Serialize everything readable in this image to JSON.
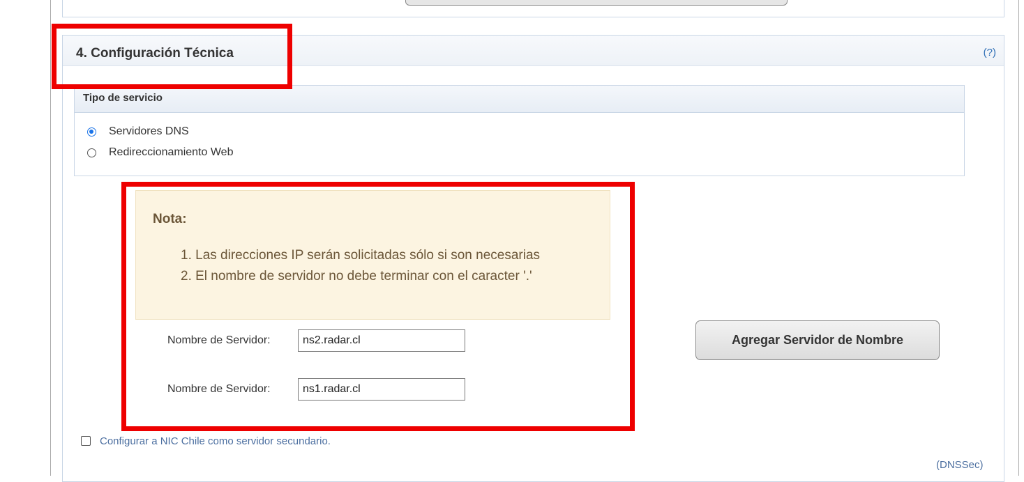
{
  "section": {
    "title": "4. Configuración Técnica",
    "help_label": "(?)"
  },
  "service_type": {
    "title": "Tipo de servicio",
    "options": [
      {
        "label": "Servidores DNS",
        "selected": true
      },
      {
        "label": "Redireccionamiento Web",
        "selected": false
      }
    ]
  },
  "note": {
    "title": "Nota:",
    "items": [
      "1. Las direcciones IP serán solicitadas sólo si son necesarias",
      "2. El nombre de servidor no debe terminar con el caracter '.'"
    ]
  },
  "servers": [
    {
      "label": "Nombre de Servidor:",
      "value": "ns2.radar.cl"
    },
    {
      "label": "Nombre de Servidor:",
      "value": "ns1.radar.cl"
    }
  ],
  "add_button_label": "Agregar Servidor de Nombre",
  "secondary_checkbox": {
    "label": "Configurar a NIC Chile como servidor secundario.",
    "checked": false
  },
  "dnssec_link": "(DNSSec)",
  "colors": {
    "highlight": "#ee0000",
    "radio_selected": "#1a73e8",
    "link": "#4c6fa0",
    "note_background": "#fcf4e1"
  }
}
